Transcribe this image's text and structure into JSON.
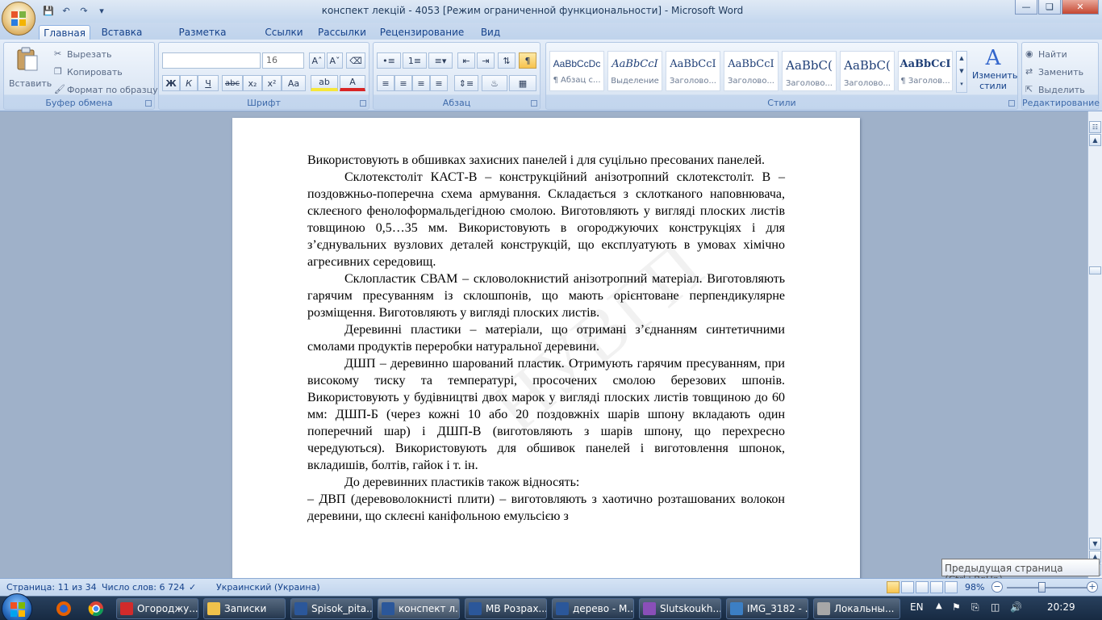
{
  "window": {
    "title": "конспект лекцій - 4053 [Режим ограниченной функциональности] - Microsoft Word"
  },
  "quick_access": [
    "save-icon",
    "undo-icon",
    "redo-icon",
    "customize-icon"
  ],
  "ribbon_tabs": [
    "Главная",
    "Вставка",
    "Разметка страницы",
    "Ссылки",
    "Рассылки",
    "Рецензирование",
    "Вид"
  ],
  "clipboard": {
    "paste": "Вставить",
    "cut": "Вырезать",
    "copy": "Копировать",
    "format_painter": "Формат по образцу",
    "label": "Буфер обмена"
  },
  "font": {
    "name_value": "",
    "size_value": "16",
    "label": "Шрифт",
    "buttons": [
      "Ж",
      "К",
      "Ч",
      "abc",
      "x₂",
      "x²",
      "Aa"
    ]
  },
  "paragraph": {
    "label": "Абзац"
  },
  "styles": {
    "label": "Стили",
    "items": [
      {
        "sample": "AaBbCcDc",
        "name": "¶ Абзац с..."
      },
      {
        "sample": "AaBbCcI",
        "name": "Выделение"
      },
      {
        "sample": "AaBbCcI",
        "name": "Заголово..."
      },
      {
        "sample": "AaBbCcI",
        "name": "Заголово..."
      },
      {
        "sample": "AaBbC(",
        "name": "Заголово..."
      },
      {
        "sample": "AaBbC(",
        "name": "Заголово..."
      },
      {
        "sample": "AaBbCcI",
        "name": "¶ Заголов..."
      }
    ],
    "change_styles": "Изменить стили"
  },
  "editing": {
    "find": "Найти",
    "replace": "Заменить",
    "select": "Выделить",
    "label": "Редактирование"
  },
  "document": {
    "paragraphs": [
      {
        "indent": false,
        "text": "Використовують в обшивках захисних панелей і для суцільно пресованих панелей."
      },
      {
        "indent": true,
        "text": "Склотекстоліт КАСТ-В – конструкційний анізотропний склотекстоліт. В – поздовжньо-поперечна схема армування. Складається з склотканого наповнювача, склеєного фенолоформальдегідною смолою. Виготовляють у вигляді плоских листів товщиною 0,5…35 мм. Використовують в огороджуючих конструкціях і для з’єднувальних вузлових деталей конструкцій, що експлуатують в умовах хімічно агресивних середовищ."
      },
      {
        "indent": true,
        "text": "Склопластик СВАМ – скловолокнистий анізотропний матеріал. Виготовляють гарячим пресуванням із склошпонів, що мають орієнтоване перпендикулярне розміщення. Виготовляють у вигляді плоских листів."
      },
      {
        "indent": true,
        "text": "Деревинні пластики – матеріали, що отримані з’єднанням синтетичними смолами продуктів переробки натуральної деревини."
      },
      {
        "indent": true,
        "text": "ДШП – деревинно шарований пластик. Отримують гарячим пресуванням, при високому тиску та температурі, просочених смолою березових шпонів. Використовують у будівництві двох марок у вигляді плоских листів товщиною до 60 мм: ДШП-Б (через кожні 10 або 20 поздовжніх шарів шпону вкладають один поперечний шар) і ДШП-В (виготовляють з шарів шпону, що перехресно чередуються). Використовують для обшивок панелей і виготовлення шпонок, вкладишів, болтів, гайок  і т. ін."
      },
      {
        "indent": true,
        "text": "До деревинних пластиків також відносять:"
      },
      {
        "indent": false,
        "text": "– ДВП (деревоволокнисті плити) – виготовляють з хаотично розташованих волокон деревини, що склеєні каніфольною емульсією з"
      }
    ]
  },
  "tooltip": "Предыдущая страница (Ctrl+PgUp)",
  "status": {
    "page": "Страница: 11 из 34",
    "words": "Число слов: 6 724",
    "language": "Украинский (Украина)",
    "zoom": "98%"
  },
  "taskbar": {
    "items": [
      {
        "label": "Огороджу...",
        "icon_color": "#d22b2b"
      },
      {
        "label": "Записки",
        "icon_color": "#f0c24b"
      },
      {
        "label": "Spisok_pita...",
        "icon_color": "#2b579a"
      },
      {
        "label": "конспект л...",
        "icon_color": "#2b579a"
      },
      {
        "label": "МВ Розрах...",
        "icon_color": "#2b579a"
      },
      {
        "label": "дерево - М...",
        "icon_color": "#2b579a"
      },
      {
        "label": "Slutskoukh...",
        "icon_color": "#8a4fb8"
      },
      {
        "label": "IMG_3182 - ...",
        "icon_color": "#3c7fc4"
      },
      {
        "label": "Локальны...",
        "icon_color": "#a7a7a7"
      }
    ],
    "lang": "EN",
    "time": "20:29"
  }
}
